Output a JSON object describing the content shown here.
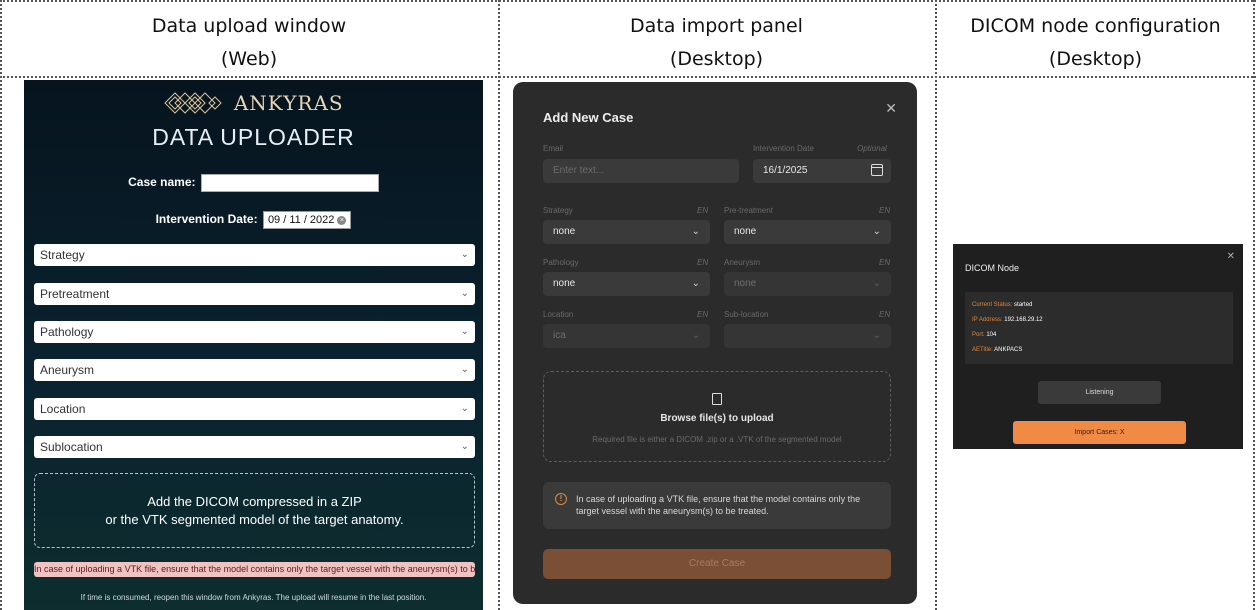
{
  "headers": [
    {
      "title": "Data upload window",
      "platform": "(Web)"
    },
    {
      "title": "Data import panel",
      "platform": "(Desktop)"
    },
    {
      "title": "DICOM node configuration",
      "platform": "(Desktop)"
    }
  ],
  "web": {
    "brand": "ANKYRAS",
    "title": "DATA UPLOADER",
    "case_label": "Case name:",
    "case_value": "",
    "date_label": "Intervention Date:",
    "date_value": "09 / 11 / 2022",
    "selects": [
      "Strategy",
      "Pretreatment",
      "Pathology",
      "Aneurysm",
      "Location",
      "Sublocation"
    ],
    "drop_line1": "Add the DICOM compressed in a ZIP",
    "drop_line2": "or the VTK segmented model of the target anatomy.",
    "warning": "In case of uploading a VTK file, ensure that the model contains only the target vessel with the aneurysm(s) to be treated.",
    "footer": "If time is consumed, reopen this window from Ankyras. The upload will resume in the last position.",
    "colors": {
      "warning_bg": "#f0c3c3",
      "brand": "#e7d7b8"
    }
  },
  "desktop": {
    "title": "Add New Case",
    "email_label": "Email",
    "email_placeholder": "Enter text...",
    "date_label": "Intervention Date",
    "date_optional": "Optional",
    "date_value": "16/1/2025",
    "lang_tag": "EN",
    "fields": [
      {
        "label": "Strategy",
        "value": "none"
      },
      {
        "label": "Pre-treatment",
        "value": "none"
      },
      {
        "label": "Pathology",
        "value": "none"
      },
      {
        "label": "Aneurysm",
        "value": "none"
      },
      {
        "label": "Location",
        "value": "ica"
      },
      {
        "label": "Sub-location",
        "value": ""
      }
    ],
    "browse_label": "Browse file(s) to upload",
    "browse_hint": "Required file is either a DICOM .zip or a .VTK of the segmented model",
    "info_text": "In case of uploading a VTK file, ensure that the model contains only the target vessel with the aneurysm(s) to be treated.",
    "create_label": "Create Case",
    "colors": {
      "accent": "#e08a3c",
      "create_bg": "#7a4f35"
    }
  },
  "node": {
    "title": "DICOM Node",
    "status_key": "Current Status:",
    "status_val": "started",
    "ip_key": "IP Address:",
    "ip_val": "192.168.29.12",
    "port_key": "Port:",
    "port_val": "104",
    "ae_key": "AETitle:",
    "ae_val": "ANKPACS",
    "listen_label": "Listening",
    "import_label": "Import Cases: X",
    "colors": {
      "key": "#e0863a",
      "import_bg": "#f08a45"
    }
  }
}
